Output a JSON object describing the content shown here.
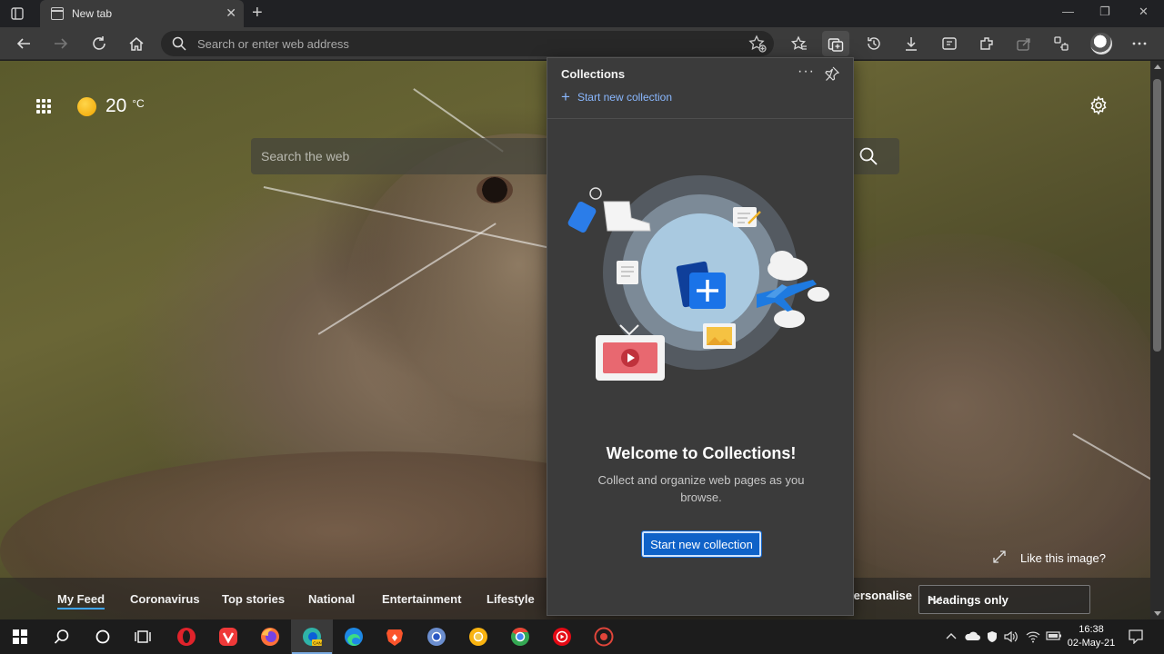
{
  "tab": {
    "title": "New tab"
  },
  "address_bar": {
    "placeholder": "Search or enter web address"
  },
  "weather": {
    "temperature": "20",
    "unit": "°C"
  },
  "web_search": {
    "placeholder": "Search the web"
  },
  "collections": {
    "title": "Collections",
    "start_link": "Start new collection",
    "welcome_title": "Welcome to Collections!",
    "description": "Collect and organize web pages as you browse.",
    "start_button": "Start new collection"
  },
  "like_image": "Like this image?",
  "feed": {
    "tabs": [
      "My Feed",
      "Coronavirus",
      "Top stories",
      "National",
      "Entertainment",
      "Lifestyle"
    ],
    "personalise": "Personalise",
    "headings_option": "Headings only"
  },
  "clock": {
    "time": "16:38",
    "date": "02-May-21"
  },
  "colors": {
    "accent": "#0f62c8",
    "link": "#8ab8ff",
    "feed_underline": "#3ea6ff"
  }
}
